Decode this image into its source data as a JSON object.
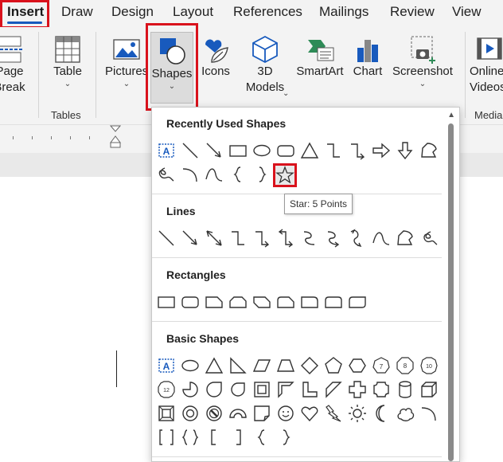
{
  "tabs": [
    {
      "label": "Insert",
      "active": true
    },
    {
      "label": "Draw"
    },
    {
      "label": "Design"
    },
    {
      "label": "Layout"
    },
    {
      "label": "References"
    },
    {
      "label": "Mailings"
    },
    {
      "label": "Review"
    },
    {
      "label": "View"
    }
  ],
  "ribbon": {
    "page_break": {
      "line1": "Page",
      "line2": "Break"
    },
    "table": "Table",
    "tables_group": "Tables",
    "pictures": "Pictures",
    "shapes": "Shapes",
    "icons": "Icons",
    "models_3d": {
      "line1": "3D",
      "line2": "Models"
    },
    "smartart": "SmartArt",
    "chart": "Chart",
    "screenshot": "Screenshot",
    "online_videos": {
      "line1": "Online",
      "line2": "Videos"
    },
    "media_group": "Media"
  },
  "shapes_menu": {
    "sections": [
      {
        "title": "Recently Used Shapes"
      },
      {
        "title": "Lines"
      },
      {
        "title": "Rectangles"
      },
      {
        "title": "Basic Shapes"
      }
    ],
    "tooltip": "Star: 5 Points",
    "highlighted_shape": "star-5-points"
  },
  "colors": {
    "accent": "#185abd",
    "highlight_border": "#d9121c",
    "ribbon_bg": "#f3f3f3"
  },
  "basic_shape_numbers": [
    "7",
    "8",
    "10",
    "12"
  ]
}
